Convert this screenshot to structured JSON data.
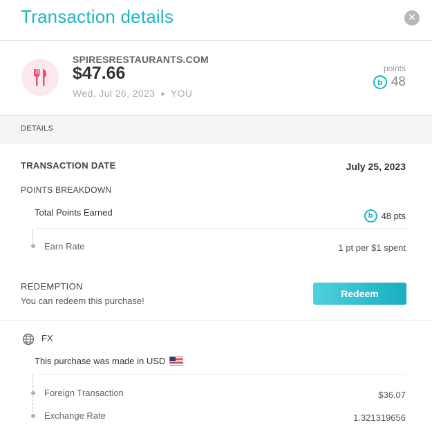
{
  "header": {
    "title": "Transaction details",
    "close_icon": "close-icon"
  },
  "summary": {
    "merchant": "SPIRESRESTAURANTS.COM",
    "amount": "$47.66",
    "date": "Wed, Jul 26, 2023",
    "owner": "YOU",
    "points_label": "points",
    "points_badge": "b",
    "points_value": "48",
    "category_icon": "fork-knife-icon",
    "icon_bg_color": "#fde8ee",
    "icon_color": "#e94f7a"
  },
  "details": {
    "section_label": "DETAILS",
    "transaction_date_label": "TRANSACTION DATE",
    "transaction_date_value": "July 25, 2023",
    "points_breakdown": {
      "label": "POINTS BREAKDOWN",
      "total_label": "Total Points Earned",
      "badge": "b",
      "total_value": "48 pts",
      "earn_rate_label": "Earn Rate",
      "earn_rate_value": "1 pt per $1 spent"
    },
    "redemption": {
      "label": "REDEMPTION",
      "sub": "You can redeem this purchase!",
      "button": "Redeem"
    },
    "fx": {
      "label": "FX",
      "icon": "globe-icon",
      "note": "This purchase was made in USD",
      "flag": "us-flag-icon",
      "foreign_label": "Foreign Transaction",
      "foreign_value": "$36.07",
      "rate_label": "Exchange Rate",
      "rate_value": "1.321319656"
    }
  },
  "colors": {
    "accent": "#1fb5c6",
    "button_start": "#4fd1de",
    "button_end": "#17aebf"
  }
}
